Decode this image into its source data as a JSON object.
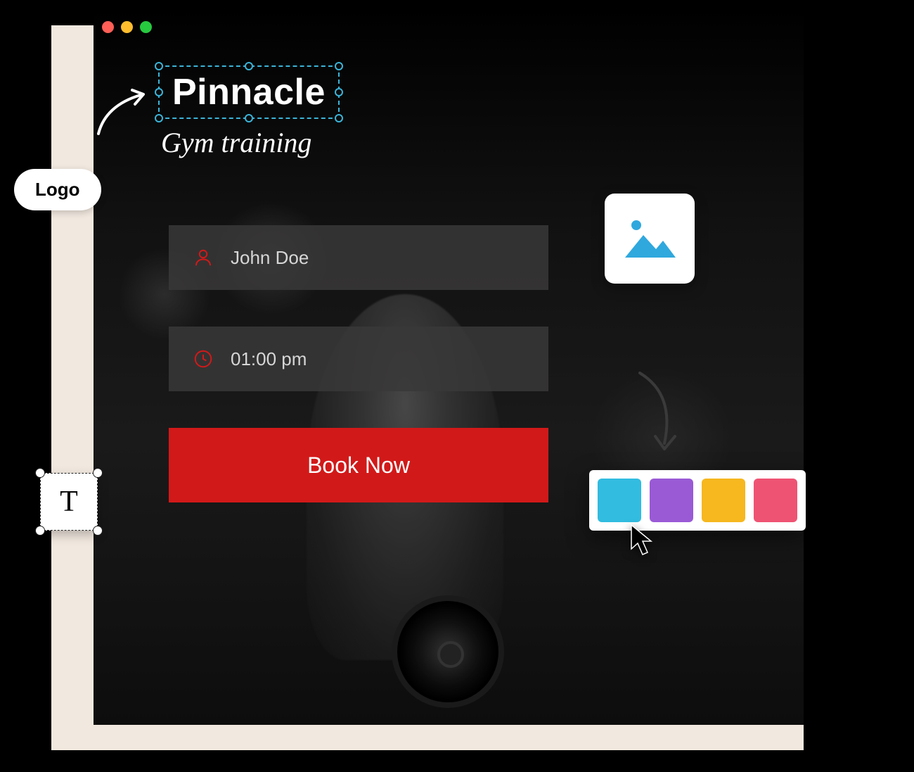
{
  "logo": {
    "title": "Pinnacle",
    "subtitle": "Gym training",
    "pill_label": "Logo"
  },
  "form": {
    "name_value": "John Doe",
    "time_value": "01:00 pm",
    "cta_label": "Book Now"
  },
  "text_widget": {
    "glyph": "T"
  },
  "palette": {
    "colors": [
      "#32bce0",
      "#9a5ad6",
      "#f6b71f",
      "#ef5373"
    ]
  },
  "icons": {
    "image_tile_accent": "#2fa8de",
    "field_accent": "#d21919"
  }
}
